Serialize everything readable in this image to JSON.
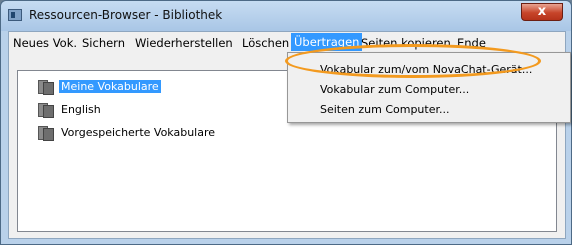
{
  "window": {
    "title": "Ressourcen-Browser - Bibliothek",
    "close_glyph": "x"
  },
  "menubar": {
    "items": [
      "Neues Vok.",
      "Sichern",
      "Wiederherstellen",
      "Löschen",
      "Übertragen",
      "Seiten kopieren",
      "Ende"
    ],
    "active_index": 4
  },
  "dropdown": {
    "items": [
      "Vokabular zum/vom NovaChat-Gerät...",
      "Vokabular zum Computer...",
      "Seiten zum Computer..."
    ]
  },
  "list": {
    "items": [
      {
        "label": "Meine Vokabulare",
        "selected": true,
        "icon": "book-icon"
      },
      {
        "label": "English",
        "selected": false,
        "icon": "book-icon"
      },
      {
        "label": "Vorgespeicherte Vokabulare",
        "selected": false,
        "icon": "book-icon"
      }
    ]
  },
  "colors": {
    "selection": "#3399ff",
    "highlight_ring": "#f39a1f",
    "close_button": "#c7452a"
  }
}
